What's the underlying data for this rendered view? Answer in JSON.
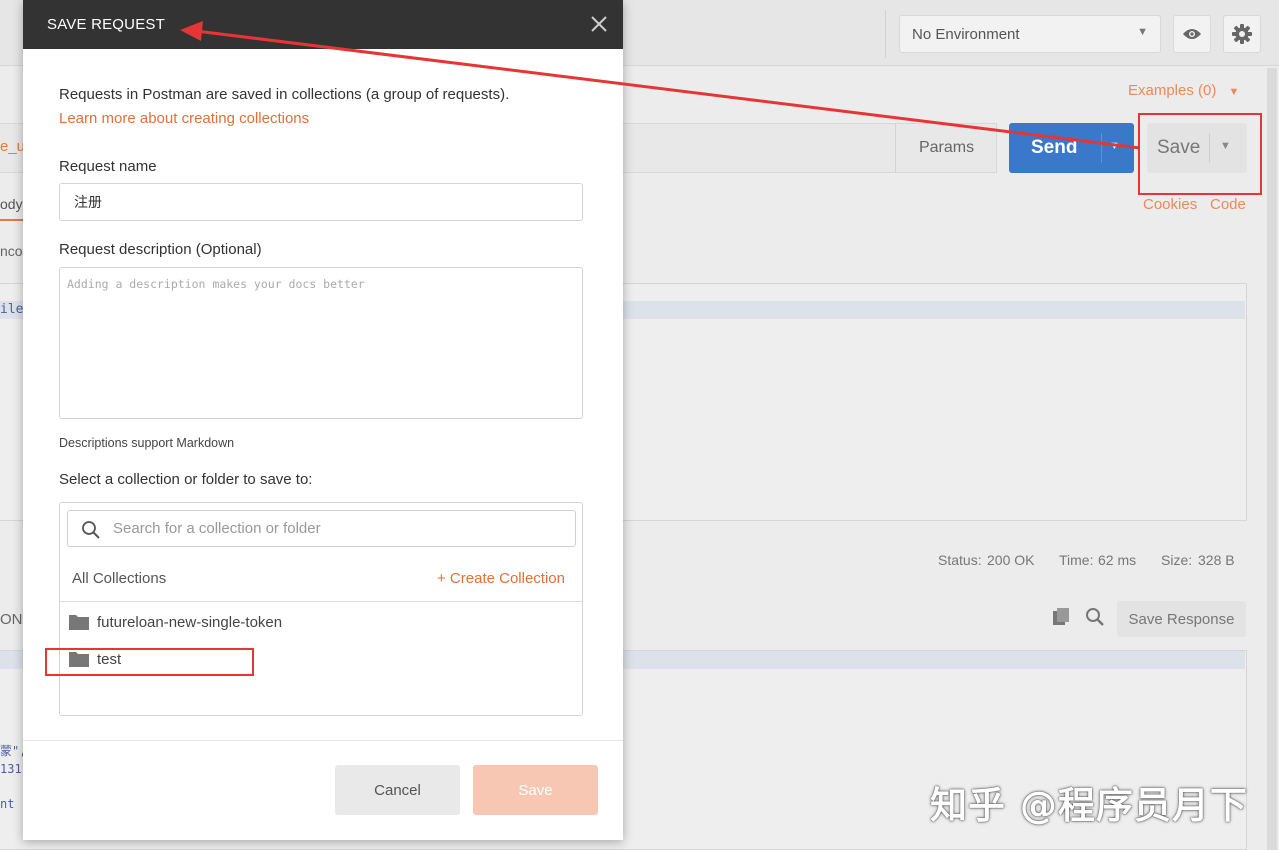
{
  "background": {
    "environment_select": "No Environment",
    "examples_label": "Examples (0)",
    "url_fragment": "e_u",
    "params_label": "Params",
    "send_label": "Send",
    "save_label": "Save",
    "cookies_label": "Cookies",
    "code_label": "Code",
    "tab_fragment": "ody",
    "encoding_fragment": "ncod",
    "body_fragment": "ile]",
    "left_fragments": [
      "ON",
      "蒙\",",
      "131",
      "nt ?"
    ],
    "status_label": "Status:",
    "status_value": "200 OK",
    "time_label": "Time:",
    "time_value": "62 ms",
    "size_label": "Size:",
    "size_value": "328 B",
    "save_response_label": "Save Response"
  },
  "modal": {
    "title": "SAVE REQUEST",
    "intro": "Requests in Postman are saved in collections (a group of requests).",
    "learn_more": "Learn more about creating collections",
    "request_name_label": "Request name",
    "request_name_value": "注册",
    "description_label": "Request description (Optional)",
    "description_placeholder": "Adding a description makes your docs better",
    "markdown_note": "Descriptions support Markdown",
    "select_label": "Select a collection or folder to save to:",
    "search_placeholder": "Search for a collection or folder",
    "all_collections": "All Collections",
    "create_collection": "+ Create Collection",
    "collections": [
      {
        "name": "futureloan-new-single-token"
      },
      {
        "name": "test"
      }
    ],
    "cancel_label": "Cancel",
    "save_label": "Save"
  },
  "watermark": "知乎 @程序员月下",
  "colors": {
    "accent": "#e0703c",
    "send_blue": "#3a79c9",
    "annotation_red": "#e53535",
    "header_dark": "#333333"
  }
}
